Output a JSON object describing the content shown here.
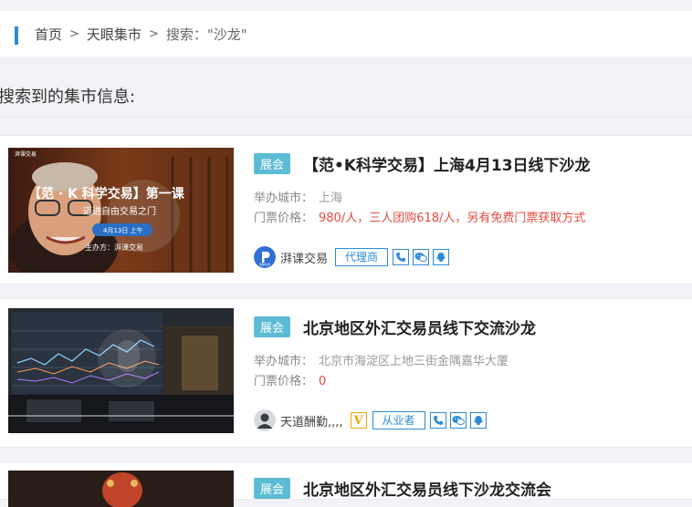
{
  "breadcrumb": {
    "home": "首页",
    "sep1": ">",
    "market": "天眼集市",
    "sep2": ">",
    "search": "搜索：\"沙龙\""
  },
  "results_heading": "搜索到的集市信息:",
  "labels": {
    "city": "举办城市：",
    "price": "门票价格："
  },
  "cards": [
    {
      "tag": "展会",
      "title": "【范•K科学交易】上海4月13日线下沙龙",
      "city": "上海",
      "price": "980/人，三人团购618/人，另有免费门票获取方式",
      "organizer": "湃课交易",
      "role": "代理商",
      "thumb_text": {
        "brand": "湃课交易",
        "headline": "【范 · K 科学交易】第一课",
        "sub": "迈进自由交易之门",
        "date": "4月13日 上午",
        "host": "主办方：湃课交易"
      },
      "avatar_text": "湃课交易"
    },
    {
      "tag": "展会",
      "title": "北京地区外汇交易员线下交流沙龙",
      "city": "北京市海淀区上地三街金隅嘉华大厦",
      "price": "0",
      "organizer": "天道酬勤,,,,",
      "verified": "V",
      "role": "从业者"
    },
    {
      "tag": "展会",
      "title": "北京地区外汇交易员线下沙龙交流会"
    }
  ],
  "colors": {
    "accent": "#2e8ad8",
    "tag_bg": "#5bbcd4",
    "price": "#e34b3f",
    "verified": "#f0a800"
  }
}
